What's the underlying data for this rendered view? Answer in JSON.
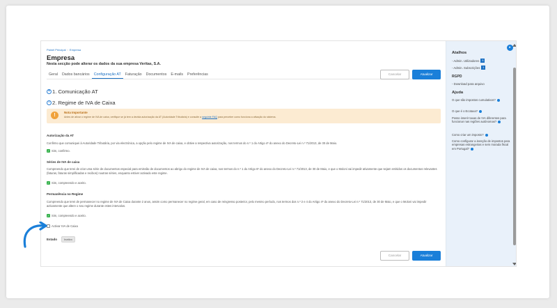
{
  "breadcrumb": {
    "home": "Painel Principal",
    "current": "Empresa"
  },
  "page": {
    "title": "Empresa",
    "subtitle": "Nesta secção pode alterar os dados da sua empresa Veritas, S.A."
  },
  "tabs": [
    "Geral",
    "Dados bancários",
    "Configuração AT",
    "Faturação",
    "Documentos",
    "E-mails",
    "Preferências"
  ],
  "actions": {
    "cancel": "Cancelar",
    "update": "Atualizar"
  },
  "sections": {
    "s1": "1. Comunicação AT",
    "s2": "2. Regime de IVA de Caixa",
    "s1_icon": "plus-circle-icon",
    "s2_icon": "minus-circle-icon"
  },
  "notice": {
    "title": "Nota Importante",
    "text_before": "Antes de ativar o regime de IVA de caixa, verifique se já tem a devida autorização da AT (Autoridade Tributária) e consulte a",
    "link": "seguinte FAQ",
    "text_after": "para perceber como funciona a ativação do sistema."
  },
  "groups": {
    "g1": {
      "title": "Autorização da AT",
      "text": "Confirmo que comuniquei à Autoridade Tributária, por via electrónica, a opção pelo regime de IVA de caixa, e obtive a respectiva autorização, nos termos do n.º 1 do Artigo 4º do anexo do Decreto-Lei n.º 71/2013, de 30 de Maio.",
      "check": "Sim, confirmo."
    },
    "g2": {
      "title": "Séries de IVA de caixa",
      "text": "Compreendo que terei de criar uma série de documentos especial para emissão de documentos ao abrigo do regime de IVA de caixa, nos termos do n.º 1 do Artigo 6º do anexo do Decreto-Lei n.º 71/2013, de 30 de Maio, e que o Moloni vai impedir ativamente que sejam emitidos os documentos relevantes (faturas, faturas simplificadas e recibos) noutras séries, enquanto estiver activado este regime.",
      "check": "Sim, compreendo e aceito."
    },
    "g3": {
      "title": "Permanência no Regime",
      "text": "Compreendo que terei de permanecer no regime de IVA de Caixa durante 2 anos, assim como permanecer no regime geral, em caso de reingresso posterior, pelo mesmo período, nos termos dos n.º 2 e 4 do Artigo 4º do anexo do Decreto-Lei n.º 71/2013, de 30 de Maio, e que o Moloni vai impedir activamente que altere o seu regime durante estes intervalos.",
      "check": "Sim, compreendo e aceito."
    },
    "activate": "Activar IVA de Caixa"
  },
  "status": {
    "label": "Estado",
    "value": "Inativo"
  },
  "sidebar": {
    "shortcuts_title": "Atalhos",
    "shortcuts": [
      {
        "label": "- Admin. Utilizadores",
        "count": "5"
      },
      {
        "label": "- Admin. Subscrições",
        "count": "1"
      }
    ],
    "rgpd_title": "RGPD",
    "rgpd_link": "- Download para arquivo",
    "help_title": "Ajuda",
    "help_items": [
      "O que são impostos cumulativos?",
      "O que é o Ecotaxa?",
      "Posso inserir taxas de IVA diferentes para funcionar nas regiões autónomas?",
      "Como criar um imposto?",
      "Como configurar a isenção de impostos para empresas estrangeiras e sem morada fiscal em Portugal?"
    ]
  },
  "colors": {
    "accent": "#1a7fd9",
    "check": "#37b24d",
    "notice_bg": "#fcebd2",
    "notice_icon": "#f0a23c",
    "rail_bg": "#e9f1fa"
  }
}
